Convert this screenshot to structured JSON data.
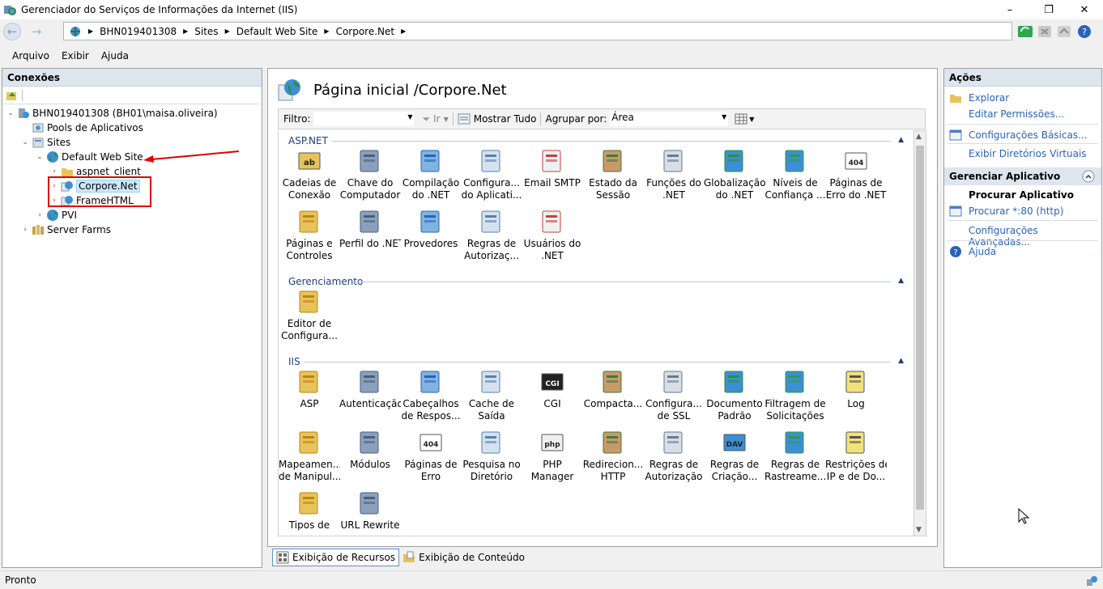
{
  "window": {
    "title": "Gerenciador do Serviços de Informações da Internet (IIS)",
    "controls": {
      "minimize": "–",
      "restore": "❐",
      "close": "✕"
    }
  },
  "address": {
    "crumbs": [
      "BHN019401308",
      "Sites",
      "Default Web Site",
      "Corpore.Net"
    ],
    "separator": "▶"
  },
  "menu": {
    "items": [
      "Arquivo",
      "Exibir",
      "Ajuda"
    ]
  },
  "connections": {
    "header": "Conexões",
    "tree": {
      "server": "BHN019401308 (BH01\\maisa.oliveira)",
      "pools": "Pools de Aplicativos",
      "sites": "Sites",
      "default_site": "Default Web Site",
      "aspnet_client": "aspnet_client",
      "corpore": "Corpore.Net",
      "framehtml": "FrameHTML",
      "pvi": "PVI",
      "farms": "Server Farms"
    }
  },
  "center": {
    "title": "Página inicial /Corpore.Net",
    "filter_label": "Filtro:",
    "go_label": "Ir",
    "show_all_label": "Mostrar Tudo",
    "group_by_label": "Agrupar por:",
    "group_by_value": "Área",
    "groups": {
      "aspnet": "ASP.NET",
      "management": "Gerenciamento",
      "iis": "IIS"
    },
    "aspnet_features": [
      [
        "Cadeias de",
        "Conexão"
      ],
      [
        "Chave do",
        "Computador"
      ],
      [
        "Compilação",
        "do .NET"
      ],
      [
        "Configura...",
        "do Aplicati..."
      ],
      [
        "Email SMTP",
        ""
      ],
      [
        "Estado da",
        "Sessão"
      ],
      [
        "Funções do",
        ".NET"
      ],
      [
        "Globalização",
        "do .NET"
      ],
      [
        "Níveis de",
        "Confiança ..."
      ],
      [
        "Páginas de",
        "Erro do .NET"
      ],
      [
        "Páginas e",
        "Controles"
      ],
      [
        "Perfil do .NET",
        ""
      ],
      [
        "Provedores",
        ""
      ],
      [
        "Regras de",
        "Autorizaç..."
      ],
      [
        "Usuários do",
        ".NET"
      ]
    ],
    "management_features": [
      [
        "Editor de",
        "Configura..."
      ]
    ],
    "iis_features": [
      [
        "ASP",
        ""
      ],
      [
        "Autenticação",
        ""
      ],
      [
        "Cabeçalhos",
        "de Respos..."
      ],
      [
        "Cache de",
        "Saída"
      ],
      [
        "CGI",
        ""
      ],
      [
        "Compacta...",
        ""
      ],
      [
        "Configura...",
        "de SSL"
      ],
      [
        "Documento",
        "Padrão"
      ],
      [
        "Filtragem de",
        "Solicitações"
      ],
      [
        "Log",
        ""
      ],
      [
        "Mapeamen...",
        "de Manipul..."
      ],
      [
        "Módulos",
        ""
      ],
      [
        "Páginas de",
        "Erro"
      ],
      [
        "Pesquisa no",
        "Diretório"
      ],
      [
        "PHP",
        "Manager"
      ],
      [
        "Redirecion...",
        "HTTP"
      ],
      [
        "Regras de",
        "Autorização"
      ],
      [
        "Regras de",
        "Criação..."
      ],
      [
        "Regras de",
        "Rastreame..."
      ],
      [
        "Restrições de",
        "IP e de Do..."
      ],
      [
        "Tipos de",
        ""
      ],
      [
        "URL Rewrite",
        ""
      ]
    ],
    "icon_texts": {
      "cgi": "CGI",
      "e404": "404",
      "php": "php",
      "dav": "DAV",
      "ab": "ab"
    }
  },
  "bottom_tabs": {
    "features_view": "Exibição de Recursos",
    "content_view": "Exibição de Conteúdo"
  },
  "actions": {
    "header": "Ações",
    "explore": "Explorar",
    "edit_permissions": "Editar Permissões...",
    "basic_settings": "Configurações Básicas...",
    "view_virtual_dirs": "Exibir Diretórios Virtuais",
    "manage_app_header": "Gerenciar Aplicativo",
    "browse_app": "Procurar Aplicativo",
    "browse_80": "Procurar *:80 (http)",
    "advanced_settings": "Configurações Avançadas...",
    "help": "Ajuda"
  },
  "status": {
    "text": "Pronto"
  },
  "colors": {
    "accent_link": "#2a63b9",
    "annotation_red": "#e00000",
    "panel_header": "#dde6ef"
  }
}
